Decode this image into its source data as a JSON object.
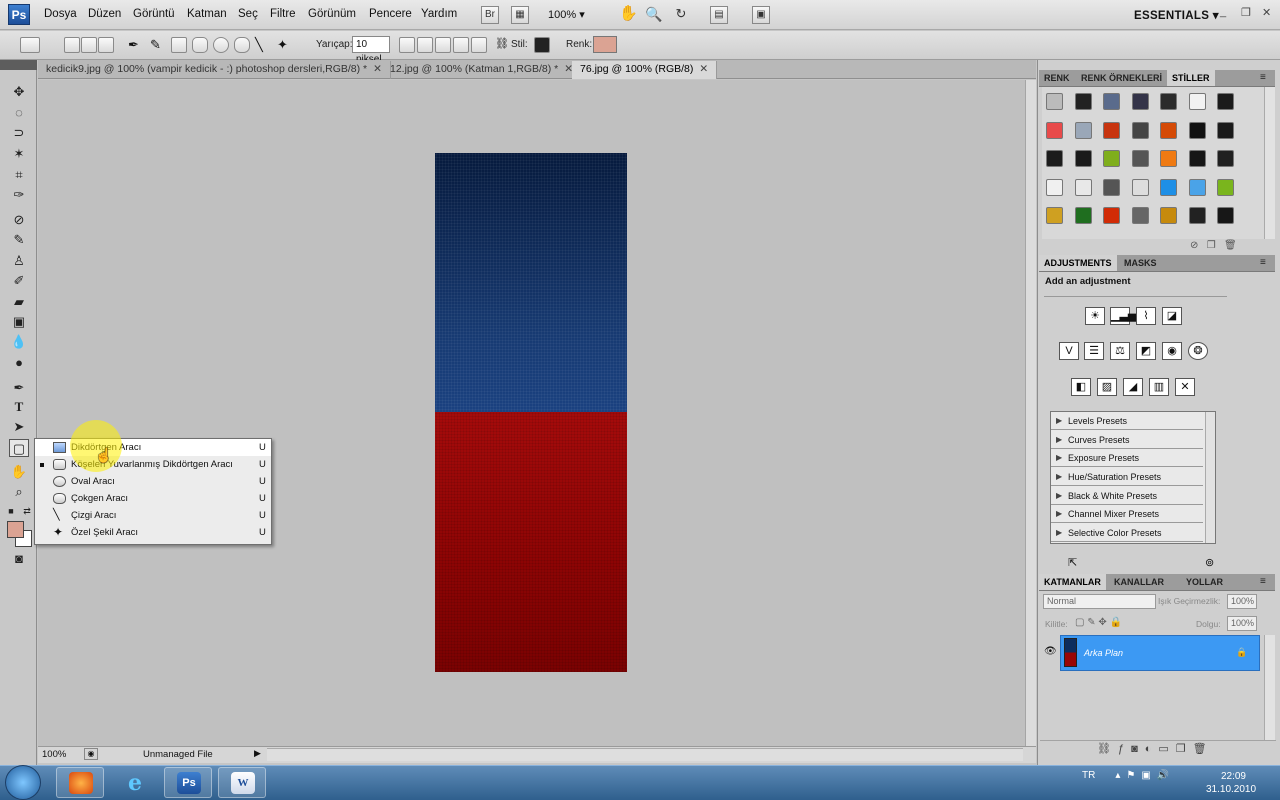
{
  "menubar": {
    "logo": "Ps",
    "items": [
      "Dosya",
      "Düzen",
      "Görüntü",
      "Katman",
      "Seç",
      "Filtre",
      "Görünüm",
      "Pencere",
      "Yardım"
    ],
    "bridge_label": "Br",
    "zoom": "100%",
    "workspace": "ESSENTIALS",
    "window_min": "_",
    "window_restore": "❐",
    "window_close": "✕"
  },
  "options": {
    "radius_label": "Yarıçap:",
    "radius_value": "10 piksel",
    "style_label": "Stil:",
    "color_label": "Renk:",
    "color_value": "#dba393"
  },
  "tabs": [
    {
      "label": "kedicik9.jpg @ 100% (vampir kedicik - :) photoshop dersleri,RGB/8) *",
      "close": "✕"
    },
    {
      "label": "12.jpg @ 100% (Katman 1,RGB/8) *",
      "close": "✕"
    },
    {
      "label": "76.jpg @ 100% (RGB/8)",
      "close": "✕"
    }
  ],
  "flyout": {
    "items": [
      {
        "label": "Dikdörtgen Aracı",
        "key": "U"
      },
      {
        "label": "Köşeleri Yuvarlanmış Dikdörtgen Aracı",
        "key": "U"
      },
      {
        "label": "Oval Aracı",
        "key": "U"
      },
      {
        "label": "Çokgen Aracı",
        "key": "U"
      },
      {
        "label": "Çizgi Aracı",
        "key": "U"
      },
      {
        "label": "Özel Şekil Aracı",
        "key": "U"
      }
    ]
  },
  "status": {
    "zoom": "100%",
    "info": "Unmanaged File"
  },
  "color_panel": {
    "tabs": [
      "RENK",
      "RENK ÖRNEKLERİ",
      "STİLLER"
    ]
  },
  "adjustments": {
    "tabs": [
      "ADJUSTMENTS",
      "MASKS"
    ],
    "title": "Add an adjustment",
    "presets": [
      "Levels Presets",
      "Curves Presets",
      "Exposure Presets",
      "Hue/Saturation Presets",
      "Black & White Presets",
      "Channel Mixer Presets",
      "Selective Color Presets"
    ]
  },
  "layers": {
    "tabs": [
      "KATMANLAR",
      "KANALLAR",
      "YOLLAR"
    ],
    "blend_mode": "Normal",
    "opacity_label": "Işık Geçirmezlik:",
    "opacity_value": "100%",
    "lock_label": "Kilitle:",
    "fill_label": "Dolgu:",
    "fill_value": "100%",
    "layer_name": "Arka Plan"
  },
  "taskbar": {
    "apps": [
      "Firefox",
      "Internet Explorer",
      "Photoshop",
      "Word"
    ],
    "lang": "TR",
    "time": "22:09",
    "date": "31.10.2010"
  }
}
